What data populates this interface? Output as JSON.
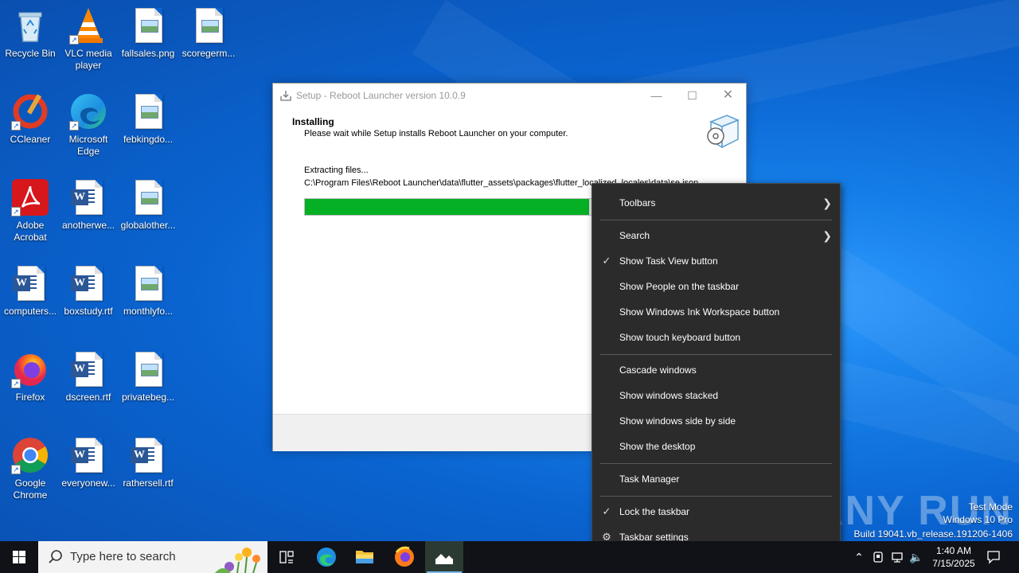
{
  "desktop": {
    "icons": [
      {
        "label": "Recycle Bin",
        "icon": "recycle-bin-icon"
      },
      {
        "label": "VLC media player",
        "icon": "vlc-icon"
      },
      {
        "label": "fallsales.png",
        "icon": "image-file-icon"
      },
      {
        "label": "scoregerm...",
        "icon": "image-file-icon"
      },
      {
        "label": "CCleaner",
        "icon": "ccleaner-icon"
      },
      {
        "label": "Microsoft Edge",
        "icon": "edge-icon"
      },
      {
        "label": "febkingdo...",
        "icon": "image-file-icon"
      },
      {
        "label": "Adobe Acrobat",
        "icon": "acrobat-icon"
      },
      {
        "label": "anotherwe...",
        "icon": "word-doc-icon"
      },
      {
        "label": "globalother...",
        "icon": "image-file-icon"
      },
      {
        "label": "computers...",
        "icon": "word-doc-icon"
      },
      {
        "label": "boxstudy.rtf",
        "icon": "word-doc-icon"
      },
      {
        "label": "monthlyfo...",
        "icon": "image-file-icon"
      },
      {
        "label": "Firefox",
        "icon": "firefox-icon"
      },
      {
        "label": "dscreen.rtf",
        "icon": "word-doc-icon"
      },
      {
        "label": "privatebeg...",
        "icon": "image-file-icon"
      },
      {
        "label": "Google Chrome",
        "icon": "chrome-icon"
      },
      {
        "label": "everyonew...",
        "icon": "word-doc-icon"
      },
      {
        "label": "rathersell.rtf",
        "icon": "word-doc-icon"
      }
    ]
  },
  "setup": {
    "title": "Setup - Reboot Launcher version 10.0.9",
    "header_title": "Installing",
    "header_sub": "Please wait while Setup installs Reboot Launcher on your computer.",
    "status": "Extracting files...",
    "path": "C:\\Program Files\\Reboot Launcher\\data\\flutter_assets\\packages\\flutter_localized_locales\\data\\se.json",
    "progress": 0.69,
    "progress_color": "#06b025"
  },
  "context_menu": {
    "items": [
      {
        "label": "Toolbars",
        "submenu": true,
        "checked": false
      },
      {
        "label": "Search",
        "submenu": true,
        "checked": false
      },
      {
        "label": "Show Task View button",
        "submenu": false,
        "checked": true
      },
      {
        "label": "Show People on the taskbar",
        "submenu": false,
        "checked": false
      },
      {
        "label": "Show Windows Ink Workspace button",
        "submenu": false,
        "checked": false
      },
      {
        "label": "Show touch keyboard button",
        "submenu": false,
        "checked": false
      },
      {
        "label": "Cascade windows",
        "submenu": false,
        "checked": false
      },
      {
        "label": "Show windows stacked",
        "submenu": false,
        "checked": false
      },
      {
        "label": "Show windows side by side",
        "submenu": false,
        "checked": false
      },
      {
        "label": "Show the desktop",
        "submenu": false,
        "checked": false
      },
      {
        "label": "Task Manager",
        "submenu": false,
        "checked": false
      },
      {
        "label": "Lock the taskbar",
        "submenu": false,
        "checked": true
      },
      {
        "label": "Taskbar settings",
        "submenu": false,
        "checked": false,
        "icon": "gear-icon"
      }
    ]
  },
  "watermark": {
    "logo": "ANY RUN",
    "line1": "Test Mode",
    "line2": "Windows 10 Pro",
    "line3": "Build 19041.vb_release.191206-1406"
  },
  "taskbar": {
    "search_placeholder": "Type here to search",
    "apps": [
      "task-view-icon",
      "edge-icon",
      "file-explorer-icon",
      "firefox-icon",
      "setup-installer-icon"
    ],
    "time": "1:40 AM",
    "date": "7/15/2025"
  }
}
